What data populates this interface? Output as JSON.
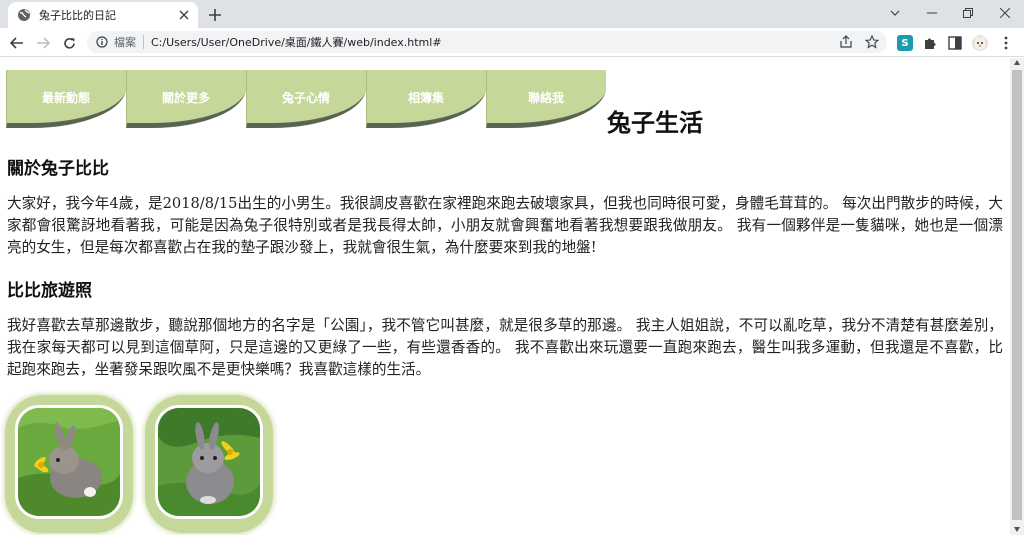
{
  "browser": {
    "tab_title": "兔子比比的日記",
    "omnibox_label": "檔案",
    "url": "C:/Users/User/OneDrive/桌面/鐵人賽/web/index.html#",
    "extension_badge": "S"
  },
  "nav": {
    "items": [
      {
        "label": "最新動態"
      },
      {
        "label": "關於更多"
      },
      {
        "label": "兔子心情"
      },
      {
        "label": "相簿集"
      },
      {
        "label": "聯絡我"
      }
    ],
    "accent": "#c6d79a",
    "shadow": "#596452"
  },
  "site_title": "兔子生活",
  "sections": [
    {
      "heading": "關於兔子比比",
      "body": "大家好，我今年4歲，是2018/8/15出生的小男生。我很調皮喜歡在家裡跑來跑去破壞家具，但我也同時很可愛，身體毛茸茸的。 每次出門散步的時候，大家都會很驚訝地看著我，可能是因為兔子很特別或者是我長得太帥，小朋友就會興奮地看著我想要跟我做朋友。 我有一個夥伴是一隻貓咪，她也是一個漂亮的女生，但是每次都喜歡占在我的墊子跟沙發上，我就會很生氣，為什麼要來到我的地盤!"
    },
    {
      "heading": "比比旅遊照",
      "body": "我好喜歡去草那邊散步，聽說那個地方的名字是「公園」，我不管它叫甚麼，就是很多草的那邊。 我主人姐姐說，不可以亂吃草，我分不清楚有甚麼差別，我在家每天都可以見到這個草阿，只是這邊的又更綠了一些，有些還香香的。 我不喜歡出來玩還要一直跑來跑去，醫生叫我多運動，但我還是不喜歡，比起跑來跑去，坐著發呆跟吹風不是更快樂嗎？我喜歡這樣的生活。"
    }
  ],
  "photos": [
    {
      "icon": "rabbit-photo-1"
    },
    {
      "icon": "rabbit-photo-2"
    }
  ]
}
